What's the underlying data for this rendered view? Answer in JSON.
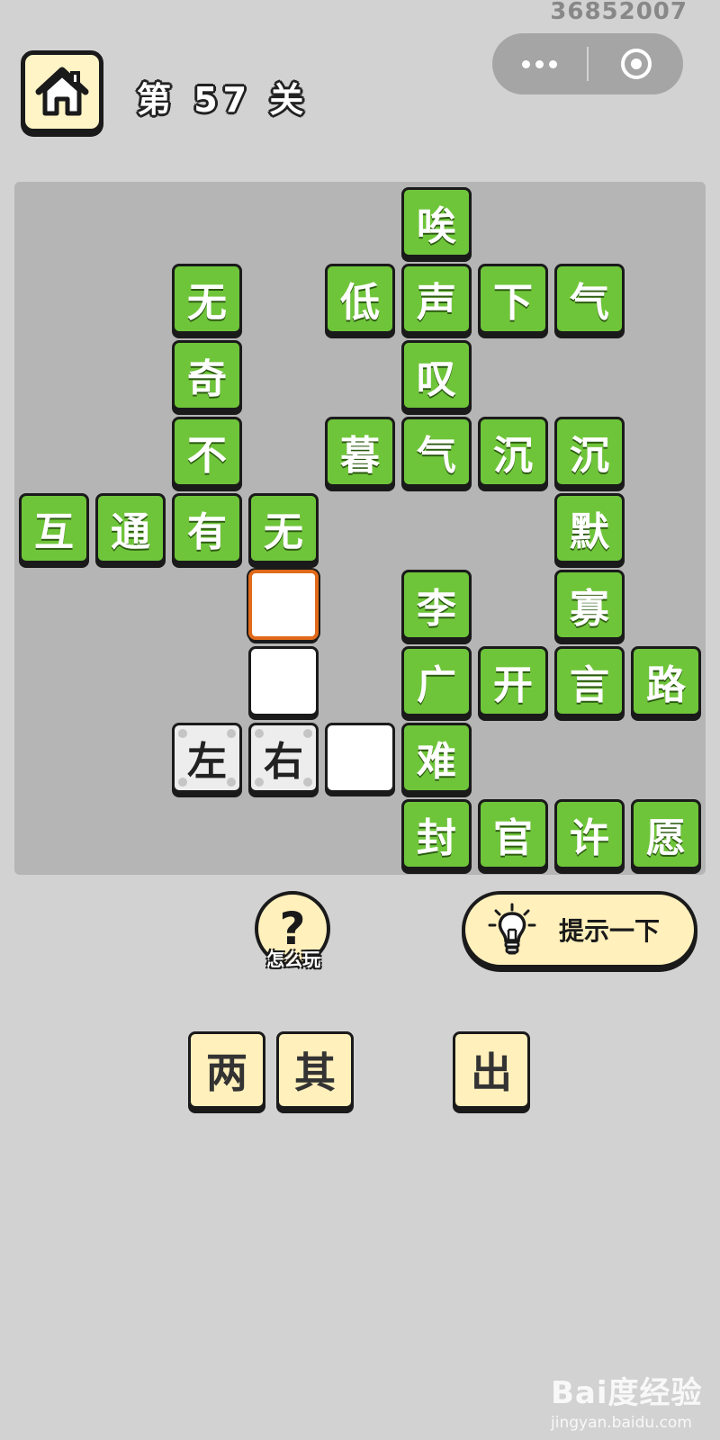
{
  "header": {
    "id_text": "36852007",
    "level_title": "第 57 关"
  },
  "colors": {
    "tile_green": "#6fc53a",
    "tile_cream": "#fff0bc",
    "board_bg": "#b5b5b5",
    "page_bg": "#d2d2d2",
    "selected_border": "#e06a1a"
  },
  "board": {
    "rows": 9,
    "cols": 9,
    "green_tiles": [
      {
        "r": 0,
        "c": 5,
        "ch": "唉"
      },
      {
        "r": 1,
        "c": 2,
        "ch": "无"
      },
      {
        "r": 1,
        "c": 4,
        "ch": "低"
      },
      {
        "r": 1,
        "c": 5,
        "ch": "声"
      },
      {
        "r": 1,
        "c": 6,
        "ch": "下"
      },
      {
        "r": 1,
        "c": 7,
        "ch": "气"
      },
      {
        "r": 2,
        "c": 2,
        "ch": "奇"
      },
      {
        "r": 2,
        "c": 5,
        "ch": "叹"
      },
      {
        "r": 3,
        "c": 2,
        "ch": "不"
      },
      {
        "r": 3,
        "c": 4,
        "ch": "暮"
      },
      {
        "r": 3,
        "c": 5,
        "ch": "气"
      },
      {
        "r": 3,
        "c": 6,
        "ch": "沉"
      },
      {
        "r": 3,
        "c": 7,
        "ch": "沉"
      },
      {
        "r": 4,
        "c": 0,
        "ch": "互"
      },
      {
        "r": 4,
        "c": 1,
        "ch": "通"
      },
      {
        "r": 4,
        "c": 2,
        "ch": "有"
      },
      {
        "r": 4,
        "c": 3,
        "ch": "无"
      },
      {
        "r": 4,
        "c": 7,
        "ch": "默"
      },
      {
        "r": 5,
        "c": 5,
        "ch": "李"
      },
      {
        "r": 5,
        "c": 7,
        "ch": "寡"
      },
      {
        "r": 6,
        "c": 5,
        "ch": "广"
      },
      {
        "r": 6,
        "c": 6,
        "ch": "开"
      },
      {
        "r": 6,
        "c": 7,
        "ch": "言"
      },
      {
        "r": 6,
        "c": 8,
        "ch": "路"
      },
      {
        "r": 7,
        "c": 5,
        "ch": "难"
      },
      {
        "r": 8,
        "c": 5,
        "ch": "封"
      },
      {
        "r": 8,
        "c": 6,
        "ch": "官"
      },
      {
        "r": 8,
        "c": 7,
        "ch": "许"
      },
      {
        "r": 8,
        "c": 8,
        "ch": "愿"
      }
    ],
    "placed_tiles": [
      {
        "r": 7,
        "c": 2,
        "ch": "左"
      },
      {
        "r": 7,
        "c": 3,
        "ch": "右"
      }
    ],
    "blank_tiles": [
      {
        "r": 5,
        "c": 3,
        "selected": true
      },
      {
        "r": 6,
        "c": 3,
        "selected": false
      },
      {
        "r": 7,
        "c": 4,
        "selected": false
      }
    ]
  },
  "controls": {
    "help_label": "怎么玩",
    "help_glyph": "?",
    "hint_label": "提示一下"
  },
  "choices": [
    "两",
    "其",
    "",
    "出"
  ],
  "watermark": {
    "logo": "Bai度经验",
    "url": "jingyan.baidu.com"
  }
}
